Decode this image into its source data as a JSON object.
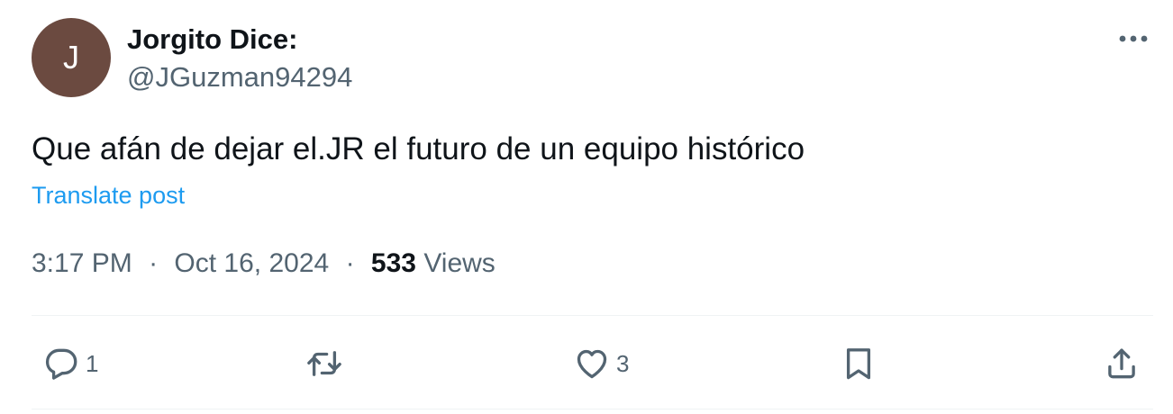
{
  "author": {
    "avatar_letter": "J",
    "display_name": "Jorgito Dice:",
    "handle": "@JGuzman94294"
  },
  "tweet": {
    "text": "Que afán de dejar el.JR el futuro de un equipo histórico",
    "translate_label": "Translate post",
    "time": "3:17 PM",
    "date": "Oct 16, 2024",
    "separator": "·",
    "views_count": "533",
    "views_label": "Views"
  },
  "actions": {
    "reply_count": "1",
    "like_count": "3"
  },
  "icons": {
    "more": "more-horizontal-icon",
    "reply": "comment-icon",
    "retweet": "retweet-icon",
    "like": "heart-icon",
    "bookmark": "bookmark-icon",
    "share": "share-icon"
  },
  "colors": {
    "avatar_bg": "#6b4a40",
    "link": "#1d9bf0",
    "secondary_text": "#536471",
    "primary_text": "#0f1419",
    "divider": "#eff3f4"
  }
}
